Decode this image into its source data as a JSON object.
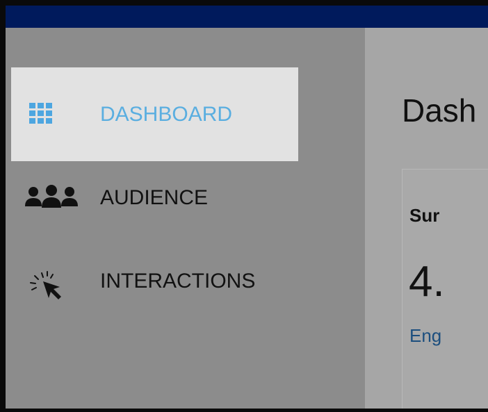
{
  "sidebar": {
    "items": [
      {
        "label": "DASHBOARD",
        "icon": "grid-icon",
        "active": true
      },
      {
        "label": "AUDIENCE",
        "icon": "users-icon",
        "active": false
      },
      {
        "label": "INTERACTIONS",
        "icon": "cursor-click-icon",
        "active": false
      }
    ]
  },
  "main": {
    "title": "Dash",
    "card": {
      "title": "Sur",
      "value": "4.",
      "subtitle": "Eng"
    }
  },
  "colors": {
    "topbar": "#001a5c",
    "sidebar": "#8c8c8c",
    "active_item_bg": "#e2e2e2",
    "active_item_text": "#5aaee0",
    "link_text": "#1c4e7e"
  }
}
